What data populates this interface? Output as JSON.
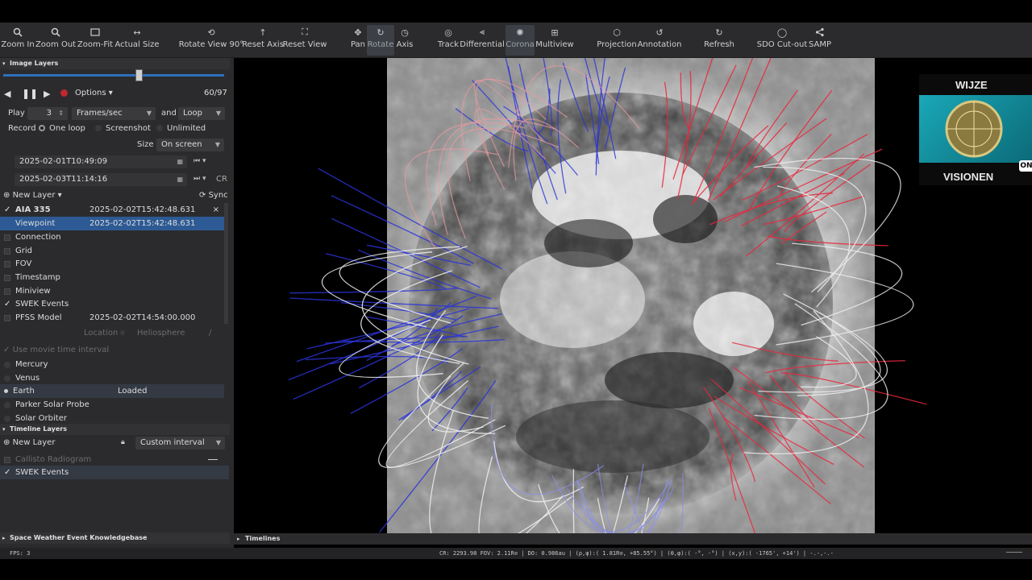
{
  "toolbar": {
    "items": [
      {
        "label": "Zoom In",
        "icon": "zoom-in-icon"
      },
      {
        "label": "Zoom Out",
        "icon": "zoom-out-icon"
      },
      {
        "label": "Zoom-Fit",
        "icon": "zoom-fit-icon"
      },
      {
        "label": "Actual Size",
        "icon": "actual-size-icon"
      },
      {
        "label": "Rotate View 90°",
        "icon": "rotate-view-icon"
      },
      {
        "label": "Reset Axis",
        "icon": "reset-axis-icon"
      },
      {
        "label": "Reset View",
        "icon": "reset-view-icon"
      },
      {
        "label": "Pan",
        "icon": "pan-icon"
      },
      {
        "label": "Rotate",
        "icon": "rotate-icon"
      },
      {
        "label": "Axis",
        "icon": "axis-icon"
      },
      {
        "label": "Track",
        "icon": "track-icon"
      },
      {
        "label": "Differential",
        "icon": "differential-icon"
      },
      {
        "label": "Corona",
        "icon": "corona-icon"
      },
      {
        "label": "Multiview",
        "icon": "multiview-icon"
      },
      {
        "label": "Projection",
        "icon": "projection-icon"
      },
      {
        "label": "Annotation",
        "icon": "annotation-icon"
      },
      {
        "label": "Refresh",
        "icon": "refresh-icon"
      },
      {
        "label": "SDO Cut-out",
        "icon": "sdo-cutout-icon"
      },
      {
        "label": "SAMP",
        "icon": "samp-icon"
      }
    ],
    "active": [
      "Rotate",
      "Corona"
    ]
  },
  "image_layers": {
    "section_title": "Image Layers",
    "options_label": "Options",
    "frame_counter": "60/97",
    "play_label": "Play",
    "play_value": "3",
    "frames_select": "Frames/sec",
    "and_label": "and",
    "loop_select": "Loop",
    "record_label": "Record",
    "record_options": [
      "One loop",
      "Screenshot",
      "Unlimited"
    ],
    "size_label": "Size",
    "size_select": "On screen",
    "start_time": "2025-02-01T10:49:09",
    "end_time": "2025-02-03T11:14:16",
    "cr_label": "CR",
    "new_layer_label": "New Layer",
    "sync_label": "Sync",
    "layers": [
      {
        "name": "AIA 335",
        "time": "2025-02-02T15:42:48.631",
        "checked": true,
        "bold": true
      },
      {
        "name": "Viewpoint",
        "time": "2025-02-02T15:42:48.631",
        "checked": false,
        "selected": true
      },
      {
        "name": "Connection",
        "time": "",
        "checked": false
      },
      {
        "name": "Grid",
        "time": "",
        "checked": false
      },
      {
        "name": "FOV",
        "time": "",
        "checked": false
      },
      {
        "name": "Timestamp",
        "time": "",
        "checked": false
      },
      {
        "name": "Miniview",
        "time": "",
        "checked": false
      },
      {
        "name": "SWEK Events",
        "time": "",
        "checked": true
      },
      {
        "name": "PFSS Model",
        "time": "2025-02-02T14:54:00.000",
        "checked": false
      }
    ],
    "viewpoint_options": [
      "Location",
      "Heliosphere"
    ],
    "use_movie_time": "Use movie time interval",
    "objects": [
      {
        "name": "Mercury",
        "status": ""
      },
      {
        "name": "Venus",
        "status": ""
      },
      {
        "name": "Earth",
        "status": "Loaded"
      },
      {
        "name": "Parker Solar Probe",
        "status": ""
      },
      {
        "name": "Solar Orbiter",
        "status": ""
      }
    ]
  },
  "timeline_layers": {
    "section_title": "Timeline Layers",
    "new_layer_label": "New Layer",
    "interval_select": "Custom interval",
    "layers": [
      {
        "name": "Callisto Radiogram",
        "checked": false,
        "disabled": true
      },
      {
        "name": "SWEK Events",
        "checked": true
      }
    ]
  },
  "swek_section": "Space Weather Event Knowledgebase",
  "timelines_label": "Timelines",
  "status_bar": {
    "fps": "FPS:  3",
    "readout": "CR: 2293.98    FOV:   2.11R⊙ | DO:   0.986au    | (ρ,ψ):(   1.81R⊙, +85.55°) | (θ,φ):(      -°,      -°) | (x,y):(  -1765',    +14') | -.-,-.-"
  },
  "overlay_logo": {
    "top_text": "WIJZE",
    "bottom_text": "VISIONEN",
    "badge": "ON"
  },
  "colors": {
    "panel_bg": "#2b2b2d",
    "selection": "#2d5a94",
    "field_red": "#e8283c",
    "field_blue": "#2a34d8",
    "field_white": "#f0f0f0"
  }
}
